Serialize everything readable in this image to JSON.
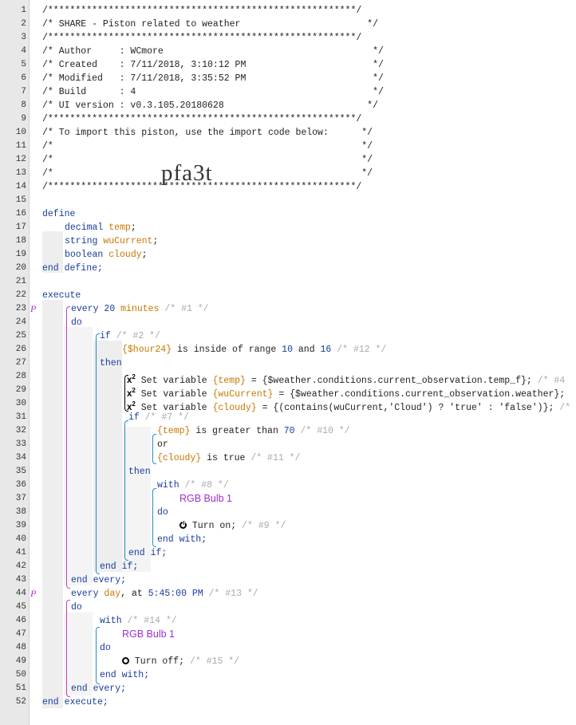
{
  "line_numbers": [
    "1",
    "2",
    "3",
    "4",
    "5",
    "6",
    "7",
    "8",
    "9",
    "10",
    "11",
    "12",
    "13",
    "14",
    "15",
    "16",
    "17",
    "18",
    "19",
    "20",
    "21",
    "22",
    "23",
    "24",
    "25",
    "26",
    "27",
    "28",
    "29",
    "30",
    "31",
    "32",
    "33",
    "34",
    "35",
    "36",
    "37",
    "38",
    "39",
    "40",
    "41",
    "42",
    "43",
    "44",
    "45",
    "46",
    "47",
    "48",
    "49",
    "50",
    "51",
    "52"
  ],
  "header": {
    "border": "/********************************************************/",
    "title": "/* SHARE - Piston related to weather                       */",
    "author": "/* Author     : WCmore                                      */",
    "created": "/* Created    : 7/11/2018, 3:10:12 PM                       */",
    "modified": "/* Modified   : 7/11/2018, 3:35:52 PM                       */",
    "build": "/* Build      : 4                                           */",
    "ui_version": "/* UI version : v0.3.105.20180628                          */",
    "import_note": "/* To import this piston, use the import code below:      */",
    "blank": "/*                                                        */",
    "import_code": "pfa3t"
  },
  "define": {
    "open": "define",
    "vars": [
      {
        "type": "decimal",
        "name": "temp"
      },
      {
        "type": "string",
        "name": "wuCurrent"
      },
      {
        "type": "boolean",
        "name": "cloudy"
      }
    ],
    "close": "end define;"
  },
  "code": {
    "execute": "execute",
    "every1_kw": "every",
    "every1_num": "20",
    "every1_unit": "minutes",
    "every1_id": "/* #1 */",
    "do": "do",
    "if1_kw": "if",
    "if1_id": "/* #2 */",
    "cond1_var": "{$hour24}",
    "cond1_text": "is inside of range",
    "cond1_lo": "10",
    "cond1_and": "and",
    "cond1_hi": "16",
    "cond1_id": "/* #12 */",
    "then": "then",
    "set_label": "Set variable",
    "set1_var": "{temp}",
    "set1_expr": "= {$weather.conditions.current_observation.temp_f};",
    "set1_id": "/* #4",
    "set2_var": "{wuCurrent}",
    "set2_expr": "= {$weather.conditions.current_observation.weather};",
    "set3_var": "{cloudy}",
    "set3_expr": "= {(contains(wuCurrent,'Cloud') ? 'true' : 'false')};",
    "set3_id": "/*",
    "if2_kw": "if",
    "if2_id": "/* #7 */",
    "cond2_var": "{temp}",
    "cond2_text": "is greater than",
    "cond2_val": "70",
    "cond2_id": "/* #10 */",
    "or": "or",
    "cond3_var": "{cloudy}",
    "cond3_text": "is true",
    "cond3_id": "/* #11 */",
    "with": "with",
    "with1_id": "/* #8 */",
    "device": "RGB Bulb 1",
    "turn_on": "Turn on;",
    "turn_on_id": "/* #9 */",
    "end_with": "end with;",
    "end_if": "end if;",
    "end_every": "end every;",
    "every2_kw": "every",
    "every2_day": "day",
    "every2_at": ", at",
    "every2_time": "5:45:00 PM",
    "every2_id": "/* #13 */",
    "with2_id": "/* #14 */",
    "turn_off": "Turn off;",
    "turn_off_id": "/* #15 */",
    "end_execute": "end execute;",
    "piston_marker": "P",
    "x_label": "x",
    "x_sup": "2"
  }
}
